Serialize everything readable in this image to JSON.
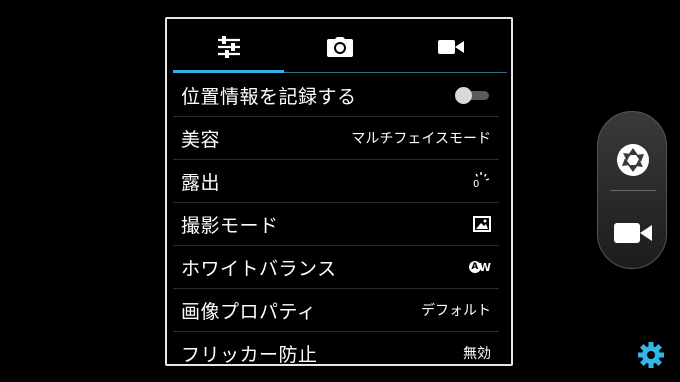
{
  "tabs": [
    {
      "icon": "sliders-icon",
      "selected": true
    },
    {
      "icon": "camera-icon",
      "selected": false
    },
    {
      "icon": "video-camera-icon",
      "selected": false
    }
  ],
  "settings": {
    "location": {
      "label": "位置情報を記録する",
      "toggle_on": false
    },
    "beauty": {
      "label": "美容",
      "value": "マルチフェイスモード"
    },
    "exposure": {
      "label": "露出",
      "value": "0"
    },
    "scene_mode": {
      "label": "撮影モード",
      "icon": "scene-auto-icon"
    },
    "white_balance": {
      "label": "ホワイトバランス",
      "value": "AW"
    },
    "image_properties": {
      "label": "画像プロパティ",
      "value": "デフォルト"
    },
    "flicker": {
      "label": "フリッカー防止",
      "value": "無効"
    }
  },
  "side_controls": {
    "shutter_icon": "shutter-icon",
    "video_icon": "video-camera-icon"
  },
  "settings_icon": "gear-icon",
  "colors": {
    "accent": "#33b5e5",
    "gear": "#33b5e5"
  }
}
